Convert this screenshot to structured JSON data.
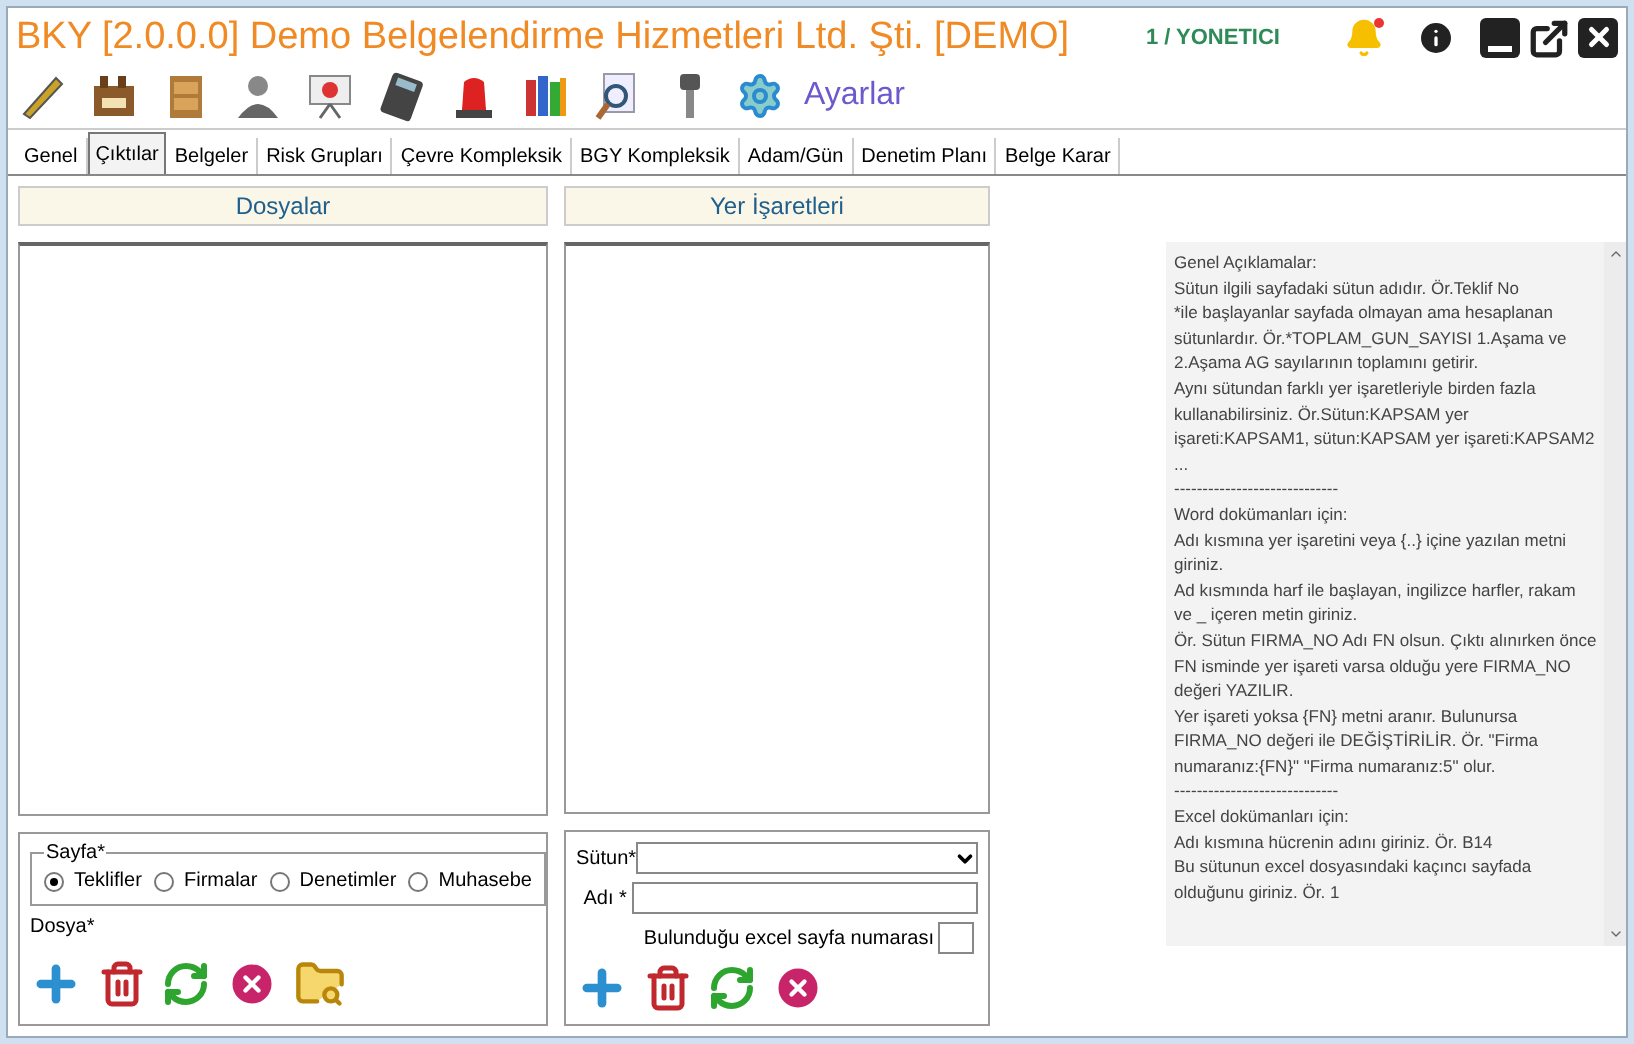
{
  "window": {
    "title": "BKY [2.0.0.0] Demo Belgelendirme Hizmetleri Ltd. Şti. [DEMO]",
    "user": "1 / YONETICI",
    "notification": true
  },
  "toolbar": {
    "settings_label": "Ayarlar"
  },
  "tabs": [
    {
      "label": "Genel",
      "selected": false
    },
    {
      "label": "Çıktılar",
      "selected": true
    },
    {
      "label": "Belgeler",
      "selected": false
    },
    {
      "label": "Risk Grupları",
      "selected": false
    },
    {
      "label": "Çevre Kompleksik",
      "selected": false
    },
    {
      "label": "BGY Kompleksik",
      "selected": false
    },
    {
      "label": "Adam/Gün",
      "selected": false
    },
    {
      "label": "Denetim Planı",
      "selected": false
    },
    {
      "label": "Belge Karar",
      "selected": false
    }
  ],
  "files_panel": {
    "header": "Dosyalar",
    "page_group": "Sayfa*",
    "pages": [
      {
        "label": "Teklifler",
        "selected": true
      },
      {
        "label": "Firmalar",
        "selected": false
      },
      {
        "label": "Denetimler",
        "selected": false
      },
      {
        "label": "Muhasebe",
        "selected": false
      }
    ],
    "file_label": "Dosya*"
  },
  "placeholders_panel": {
    "header": "Yer İşaretleri",
    "column_label": "Sütun*",
    "name_label": "Adı *",
    "sheet_label": "Bulunduğu excel sayfa numarası"
  },
  "help_lines": [
    "Genel Açıklamalar:",
    "Sütun ilgili sayfadaki sütun adıdır. Ör.Teklif No",
    "*ile başlayanlar sayfada olmayan ama hesaplanan",
    "sütunlardır. Ör.*TOPLAM_GUN_SAYISI 1.Aşama ve",
    "2.Aşama AG sayılarının toplamını getirir.",
    "Aynı sütundan farklı yer işaretleriyle birden fazla",
    "kullanabilirsiniz. Ör.Sütun:KAPSAM yer",
    "işareti:KAPSAM1, sütun:KAPSAM yer işareti:KAPSAM2",
    "...",
    "-----------------------------",
    "Word dokümanları için:",
    "Adı kısmına yer işaretini veya {..} içine yazılan metni",
    "giriniz.",
    "Ad kısmında harf ile başlayan, ingilizce harfler, rakam",
    "ve _  içeren metin giriniz.",
    "Ör. Sütun FIRMA_NO Adı FN olsun. Çıktı alınırken önce",
    "FN isminde yer işareti varsa olduğu yere FIRMA_NO",
    "değeri YAZILIR.",
    "Yer işareti yoksa {FN} metni aranır. Bulunursa",
    "FIRMA_NO değeri ile DEĞİŞTİRİLİR. Ör. \"Firma",
    "numaranız:{FN}\" \"Firma numaranız:5\" olur.",
    "-----------------------------",
    "Excel dokümanları için:",
    "Adı kısmına hücrenin adını giriniz. Ör. B14",
    "Bu sütunun excel dosyasındaki kaçıncı sayfada",
    "olduğunu giriniz. Ör. 1"
  ]
}
